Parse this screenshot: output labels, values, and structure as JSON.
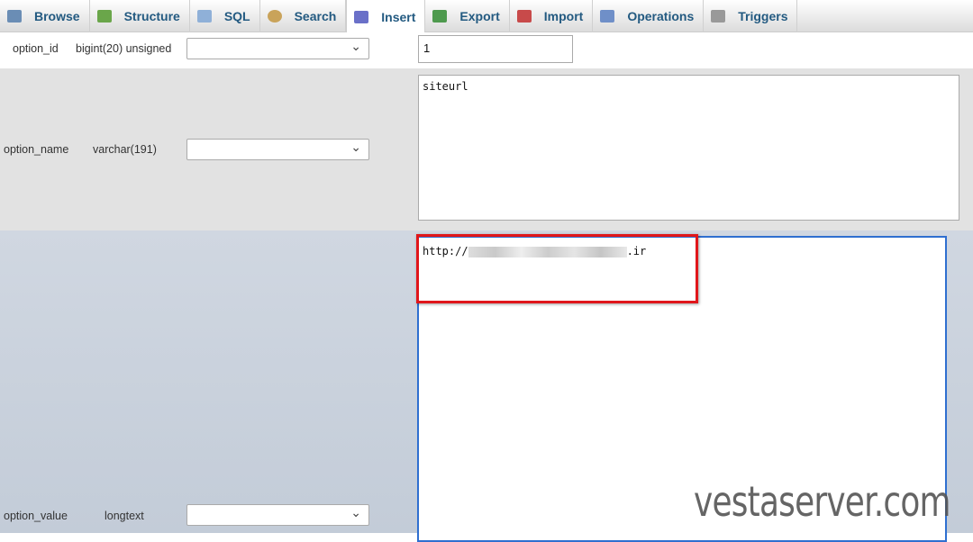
{
  "tabs": [
    {
      "label": "Browse",
      "icon": "table-icon",
      "color": "#6a8db5"
    },
    {
      "label": "Structure",
      "icon": "structure-icon",
      "color": "#6aa64a"
    },
    {
      "label": "SQL",
      "icon": "sql-scroll-icon",
      "color": "#8fb0d8"
    },
    {
      "label": "Search",
      "icon": "magnifier-icon",
      "color": "#c9a35a"
    },
    {
      "label": "Insert",
      "icon": "insert-icon",
      "color": "#6a70c8"
    },
    {
      "label": "Export",
      "icon": "export-icon",
      "color": "#4e9a4e"
    },
    {
      "label": "Import",
      "icon": "import-icon",
      "color": "#c84a4a"
    },
    {
      "label": "Operations",
      "icon": "wrench-icon",
      "color": "#6f8fc8"
    },
    {
      "label": "Triggers",
      "icon": "triggers-icon",
      "color": "#999999"
    }
  ],
  "active_tab": "Insert",
  "rows": [
    {
      "column": "option_id",
      "type": "bigint(20) unsigned",
      "value": "1"
    },
    {
      "column": "option_name",
      "type": "varchar(191)",
      "value": "siteurl"
    },
    {
      "column": "option_value",
      "type": "longtext",
      "value_prefix": "http://",
      "value_suffix": ".ir"
    }
  ],
  "watermark": "vestaserver.com"
}
